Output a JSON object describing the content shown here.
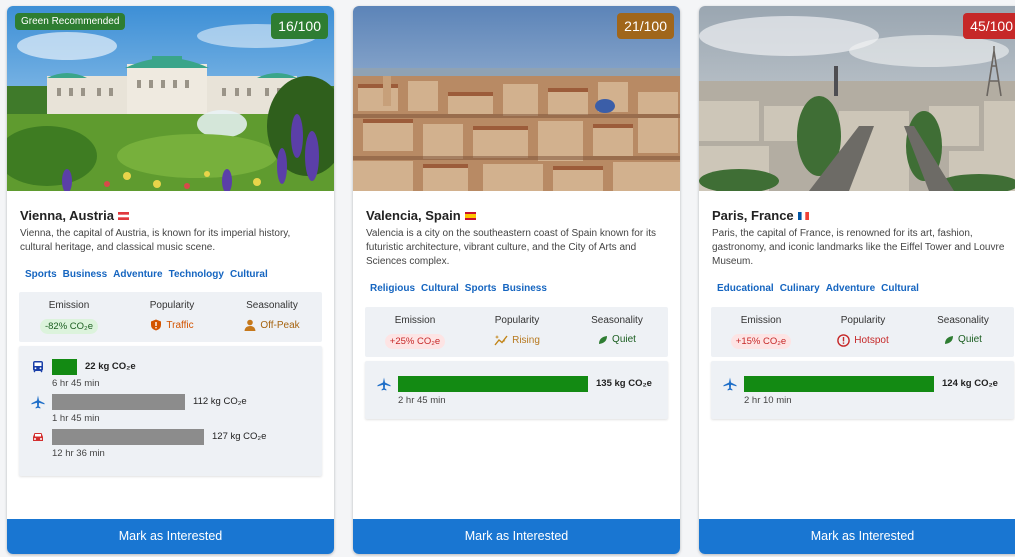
{
  "cards": [
    {
      "badge": "Green Recommended",
      "score": "16/100",
      "score_color": "#2e7d32",
      "city": "Vienna, Austria",
      "flag": "austria",
      "description": "Vienna, the capital of Austria, is known for its imperial history, cultural heritage, and classical music scene.",
      "tags": [
        "Sports",
        "Business",
        "Adventure",
        "Technology",
        "Cultural"
      ],
      "metrics": {
        "emission_label": "Emission",
        "emission_value": "-82% CO₂e",
        "popularity_label": "Popularity",
        "popularity_value": "Traffic",
        "popularity_icon": "shield-alert-icon",
        "seasonality_label": "Seasonality",
        "seasonality_value": "Off-Peak",
        "seasonality_icon": "person-icon"
      },
      "transport": [
        {
          "mode": "train",
          "icon": "train-icon",
          "emission": "22 kg CO₂e",
          "duration": "6 hr 45 min",
          "share": 0.13,
          "color": "#138a13",
          "bold": true
        },
        {
          "mode": "plane",
          "icon": "plane-icon",
          "emission": "112 kg CO₂e",
          "duration": "1 hr 45 min",
          "share": 0.7,
          "color": "#8c8c8c",
          "bold": false
        },
        {
          "mode": "car",
          "icon": "car-icon",
          "emission": "127 kg CO₂e",
          "duration": "12 hr 36 min",
          "share": 0.8,
          "color": "#8c8c8c",
          "bold": false
        }
      ],
      "button": "Mark as Interested"
    },
    {
      "score": "21/100",
      "score_color": "#a0661b",
      "city": "Valencia, Spain",
      "flag": "spain",
      "description": "Valencia is a city on the southeastern coast of Spain known for its futuristic architecture, vibrant culture, and the City of Arts and Sciences complex.",
      "tags": [
        "Religious",
        "Cultural",
        "Sports",
        "Business"
      ],
      "metrics": {
        "emission_label": "Emission",
        "emission_value": "+25% CO₂e",
        "popularity_label": "Popularity",
        "popularity_value": "Rising",
        "popularity_icon": "sparkle-trend-icon",
        "seasonality_label": "Seasonality",
        "seasonality_value": "Quiet",
        "seasonality_icon": "leaf-icon"
      },
      "transport": [
        {
          "mode": "plane",
          "icon": "plane-icon",
          "emission": "135 kg CO₂e",
          "duration": "2 hr 45 min",
          "share": 1.0,
          "color": "#138a13",
          "bold": true
        }
      ],
      "button": "Mark as Interested"
    },
    {
      "score": "45/100",
      "score_color": "#c62828",
      "city": "Paris, France",
      "flag": "france",
      "description": "Paris, the capital of France, is renowned for its art, fashion, gastronomy, and iconic landmarks like the Eiffel Tower and Louvre Museum.",
      "tags": [
        "Educational",
        "Culinary",
        "Adventure",
        "Cultural"
      ],
      "metrics": {
        "emission_label": "Emission",
        "emission_value": "+15% CO₂e",
        "popularity_label": "Popularity",
        "popularity_value": "Hotspot",
        "popularity_icon": "alert-circle-icon",
        "seasonality_label": "Seasonality",
        "seasonality_value": "Quiet",
        "seasonality_icon": "leaf-icon"
      },
      "transport": [
        {
          "mode": "plane",
          "icon": "plane-icon",
          "emission": "124 kg CO₂e",
          "duration": "2 hr 10 min",
          "share": 1.0,
          "color": "#138a13",
          "bold": true
        }
      ],
      "button": "Mark as Interested"
    }
  ]
}
